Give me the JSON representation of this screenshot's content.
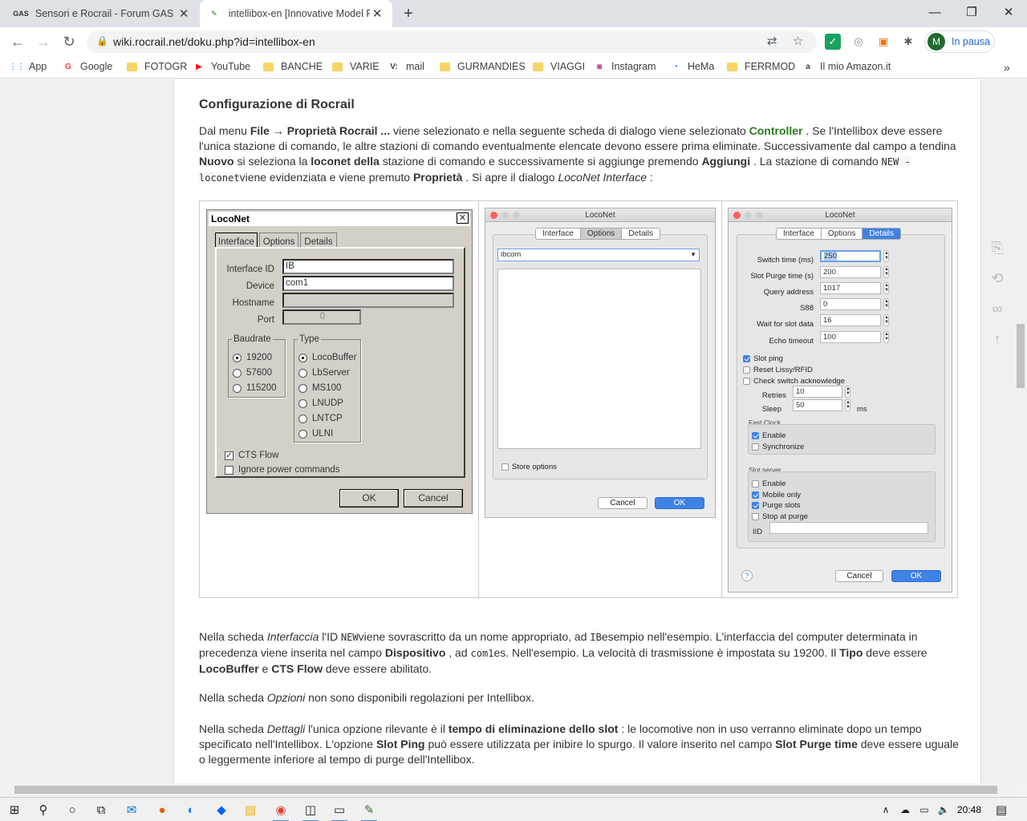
{
  "browser": {
    "tabs": [
      {
        "favicon": "GAS",
        "title": "Sensori e Rocrail - Forum GAS TT",
        "active": false
      },
      {
        "favicon": "rocrail-icon",
        "title": "intellibox-en [Innovative Model R",
        "active": true
      }
    ],
    "url": "wiki.rocrail.net/doku.php?id=intellibox-en",
    "profile": {
      "initial": "M",
      "status": "In pausa"
    }
  },
  "bookmarks": [
    {
      "label": "App",
      "icon": "apps-grid-icon"
    },
    {
      "label": "Google",
      "icon": "google-icon"
    },
    {
      "label": "FOTOGR",
      "icon": "folder-icon"
    },
    {
      "label": "YouTube",
      "icon": "youtube-icon"
    },
    {
      "label": "BANCHE",
      "icon": "folder-icon"
    },
    {
      "label": "VARIE",
      "icon": "folder-icon"
    },
    {
      "label": "mail",
      "icon": "v-icon"
    },
    {
      "label": "GURMANDIES",
      "icon": "folder-icon"
    },
    {
      "label": "VIAGGI",
      "icon": "folder-icon"
    },
    {
      "label": "Instagram",
      "icon": "instagram-icon"
    },
    {
      "label": "HeMa",
      "icon": "hema-icon"
    },
    {
      "label": "FERRMOD",
      "icon": "folder-icon"
    },
    {
      "label": "Il mio Amazon.it",
      "icon": "amazon-icon"
    }
  ],
  "article": {
    "heading": "Configurazione di Rocrail",
    "p1": {
      "t1": "Dal menu ",
      "b1": "File → Proprietà Rocrail ...",
      "t2": " viene selezionato e nella seguente scheda di dialogo viene selezionato ",
      "g1": "Controller",
      "t3": " . Se l'Intellibox deve essere l'unica stazione di comando, le altre stazioni di comando eventualmente elencate devono essere prima eliminate. Successivamente dal campo a tendina ",
      "b2": "Nuovo",
      "t4": " si seleziona la ",
      "b3": "loconet della",
      "t5": " stazione di comando e successivamente si aggiunge premendo ",
      "b4": "Aggiungi",
      "t6": " . La stazione di comando ",
      "c1": "NEW - loconet",
      "t7": "viene evidenziata e viene premuto ",
      "b5": "Proprietà",
      "t8": " . Si apre il dialogo ",
      "i1": "LocoNet Interface",
      "t9": " :"
    },
    "p2": {
      "t1": "Nella scheda ",
      "i1": "Interfaccia",
      "t2": " l'ID ",
      "c1": "NEW",
      "t3": "viene sovrascritto da un nome appropriato, ad ",
      "c2": "IB",
      "t4": "esempio nell'esempio. L'interfaccia del computer determinata in precedenza viene inserita nel campo ",
      "b1": "Dispositivo",
      "t5": " , ad ",
      "c3": "com1",
      "t6": "es. Nell'esempio. La velocità di trasmissione è impostata su 19200. Il ",
      "b2": "Tipo",
      "t7": " deve essere ",
      "b3": "LocoBuffer",
      "t8": " e ",
      "b4": "CTS Flow",
      "t9": " deve essere abilitato."
    },
    "p3": {
      "t1": "Nella scheda ",
      "i1": "Opzioni",
      "t2": " non sono disponibili regolazioni per Intellibox."
    },
    "p4": {
      "t1": "Nella scheda ",
      "i1": "Dettagli",
      "t2": " l'unica opzione rilevante è il ",
      "b1": "tempo di eliminazione dello slot",
      "t3": " : le locomotive non in uso verranno eliminate dopo un tempo specificato nell'Intellibox. L'opzione ",
      "b2": "Slot Ping",
      "t4": " può essere utilizzata per inibire lo spurgo. Il valore inserito nel campo ",
      "b3": "Slot Purge time",
      "t5": " deve essere uguale o leggermente inferiore al tempo di purge dell'Intellibox."
    }
  },
  "dialog1": {
    "title": "LocoNet",
    "tabs": [
      "Interface",
      "Options",
      "Details"
    ],
    "fields": {
      "interface_id_label": "Interface ID",
      "interface_id": "IB",
      "device_label": "Device",
      "device": "com1",
      "hostname_label": "Hostname",
      "hostname": "",
      "port_label": "Port",
      "port": "0"
    },
    "baudrate": {
      "legend": "Baudrate",
      "options": [
        "19200",
        "57600",
        "115200"
      ],
      "selected": "19200"
    },
    "type": {
      "legend": "Type",
      "options": [
        "LocoBuffer",
        "LbServer",
        "MS100",
        "LNUDP",
        "LNTCP",
        "ULNI"
      ],
      "selected": "LocoBuffer"
    },
    "cts_flow": "CTS Flow",
    "ignore_power": "Ignore power commands",
    "ok": "OK",
    "cancel": "Cancel"
  },
  "dialog2": {
    "title": "LocoNet",
    "tabs": [
      "Interface",
      "Options",
      "Details"
    ],
    "selected_tab": "Options",
    "combo_value": "ibcom",
    "store_options": "Store options",
    "cancel": "Cancel",
    "ok": "OK"
  },
  "dialog3": {
    "title": "LocoNet",
    "tabs": [
      "Interface",
      "Options",
      "Details"
    ],
    "selected_tab": "Details",
    "fields": [
      {
        "label": "Switch time (ms)",
        "value": "250"
      },
      {
        "label": "Slot Purge time (s)",
        "value": "200"
      },
      {
        "label": "Query address",
        "value": "1017"
      },
      {
        "label": "S88",
        "value": "0"
      },
      {
        "label": "Wait for slot data",
        "value": "16"
      },
      {
        "label": "Echo timeout",
        "value": "100"
      }
    ],
    "checks": [
      {
        "label": "Slot ping",
        "checked": true
      },
      {
        "label": "Reset Lissy/RFID",
        "checked": false
      },
      {
        "label": "Check switch acknowledge",
        "checked": false
      }
    ],
    "retries_label": "Retries",
    "retries": "10",
    "sleep_label": "Sleep",
    "sleep": "50",
    "sleep_unit": "ms",
    "fast_clock": {
      "title": "Fast Clock",
      "enable": "Enable",
      "synchronize": "Synchronize"
    },
    "slot_server": {
      "title": "Slot server",
      "enable": "Enable",
      "mobile_only": "Mobile only",
      "purge_slots": "Purge slots",
      "stop_at_purge": "Stop at purge",
      "iid": "IID"
    },
    "help": "?",
    "cancel": "Cancel",
    "ok": "OK"
  },
  "taskbar": {
    "time": "20:48"
  }
}
